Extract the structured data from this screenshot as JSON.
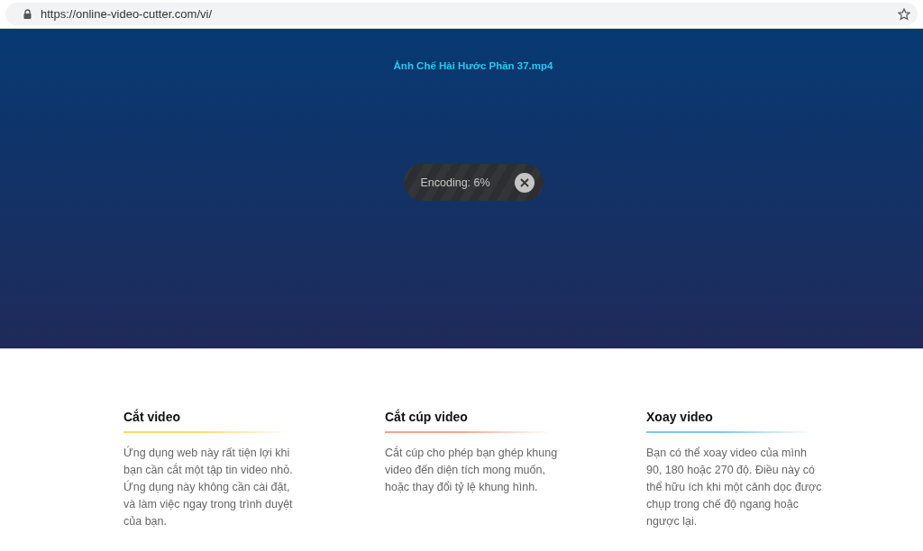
{
  "browser": {
    "url": "https://online-video-cutter.com/vi/"
  },
  "upload": {
    "file_name": "Ảnh Chế Hài Hước Phần 37.mp4",
    "status": "Encoding: 6%"
  },
  "features": [
    {
      "title": "Cắt video",
      "color": "#fbd96a",
      "description": "Ứng dụng web này rất tiện lợi khi bạn cần cắt một tập tin video nhỏ. Ứng dụng này không cần cài đặt, và làm việc ngay trong trình duyệt của bạn."
    },
    {
      "title": "Cắt cúp video",
      "color": "#f7a48a",
      "description": "Cắt cúp cho phép bạn ghép khung video đến diện tích mong muốn, hoặc thay đổi tỷ lệ khung hình."
    },
    {
      "title": "Xoay video",
      "color": "#7cc8f0",
      "description": "Bạn có thể xoay video của mình 90, 180 hoặc 270 độ. Điều này có thể hữu ích khi một cảnh dọc được chụp trong chế độ ngang hoặc ngược lại."
    }
  ]
}
